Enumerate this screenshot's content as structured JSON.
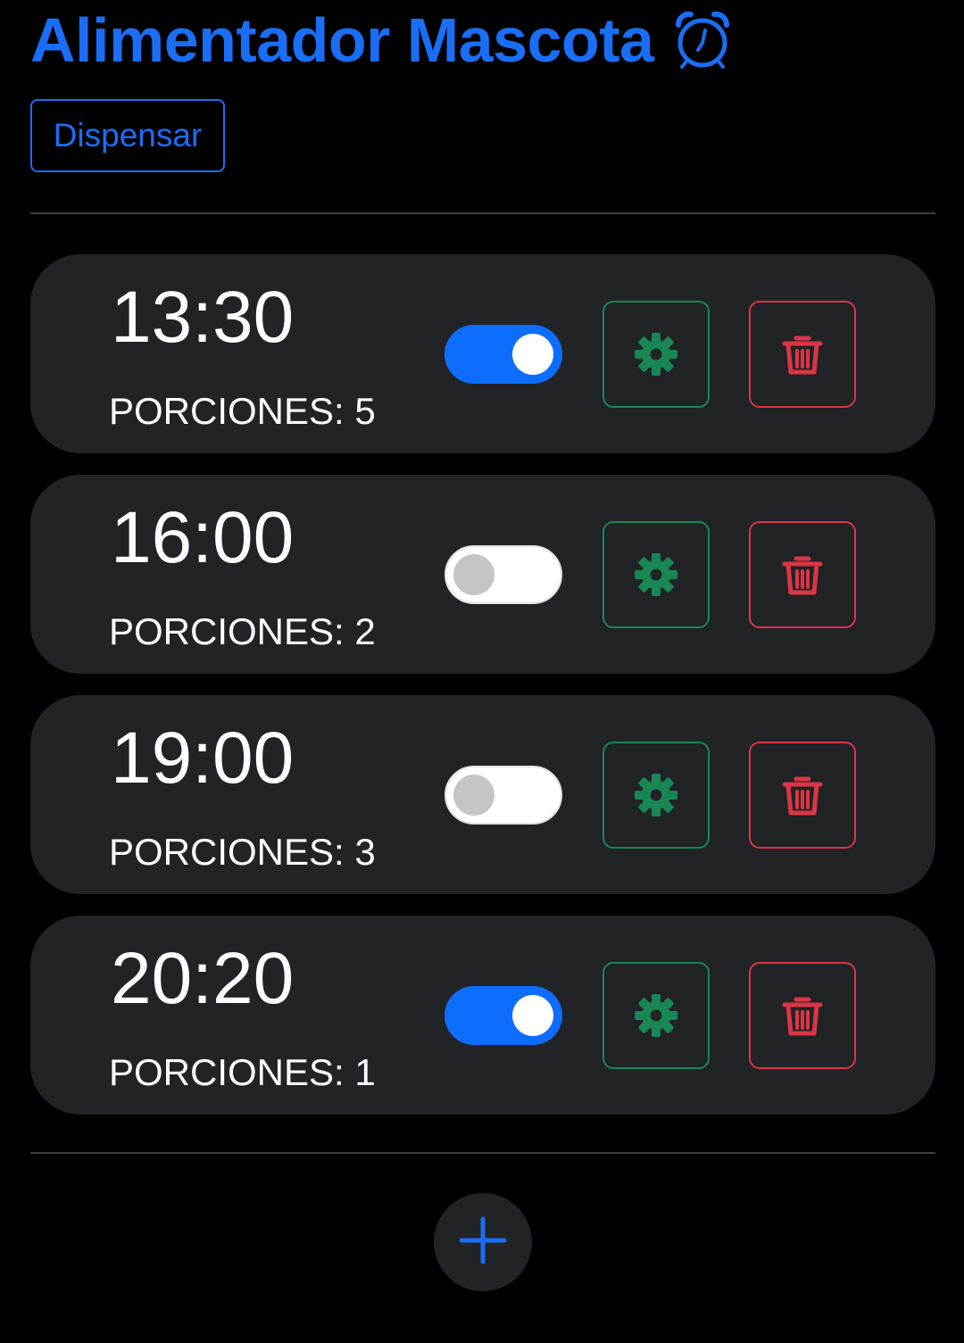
{
  "app": {
    "title": "Alimentador Mascota",
    "title_icon": "alarm-clock-icon",
    "accent_color": "#1a6ef5"
  },
  "actions": {
    "dispense_label": "Dispensar",
    "add_icon": "plus-icon"
  },
  "schedules": [
    {
      "time": "13:30",
      "portions_label": "PORCIONES: 5",
      "enabled": true
    },
    {
      "time": "16:00",
      "portions_label": "PORCIONES: 2",
      "enabled": false
    },
    {
      "time": "19:00",
      "portions_label": "PORCIONES: 3",
      "enabled": false
    },
    {
      "time": "20:20",
      "portions_label": "PORCIONES: 1",
      "enabled": true
    }
  ],
  "icons": {
    "settings": "gear-icon",
    "delete": "trash-icon"
  },
  "colors": {
    "card_background": "#212327",
    "toggle_on": "#0d6efd",
    "settings": "#198754",
    "delete": "#dc3545"
  }
}
